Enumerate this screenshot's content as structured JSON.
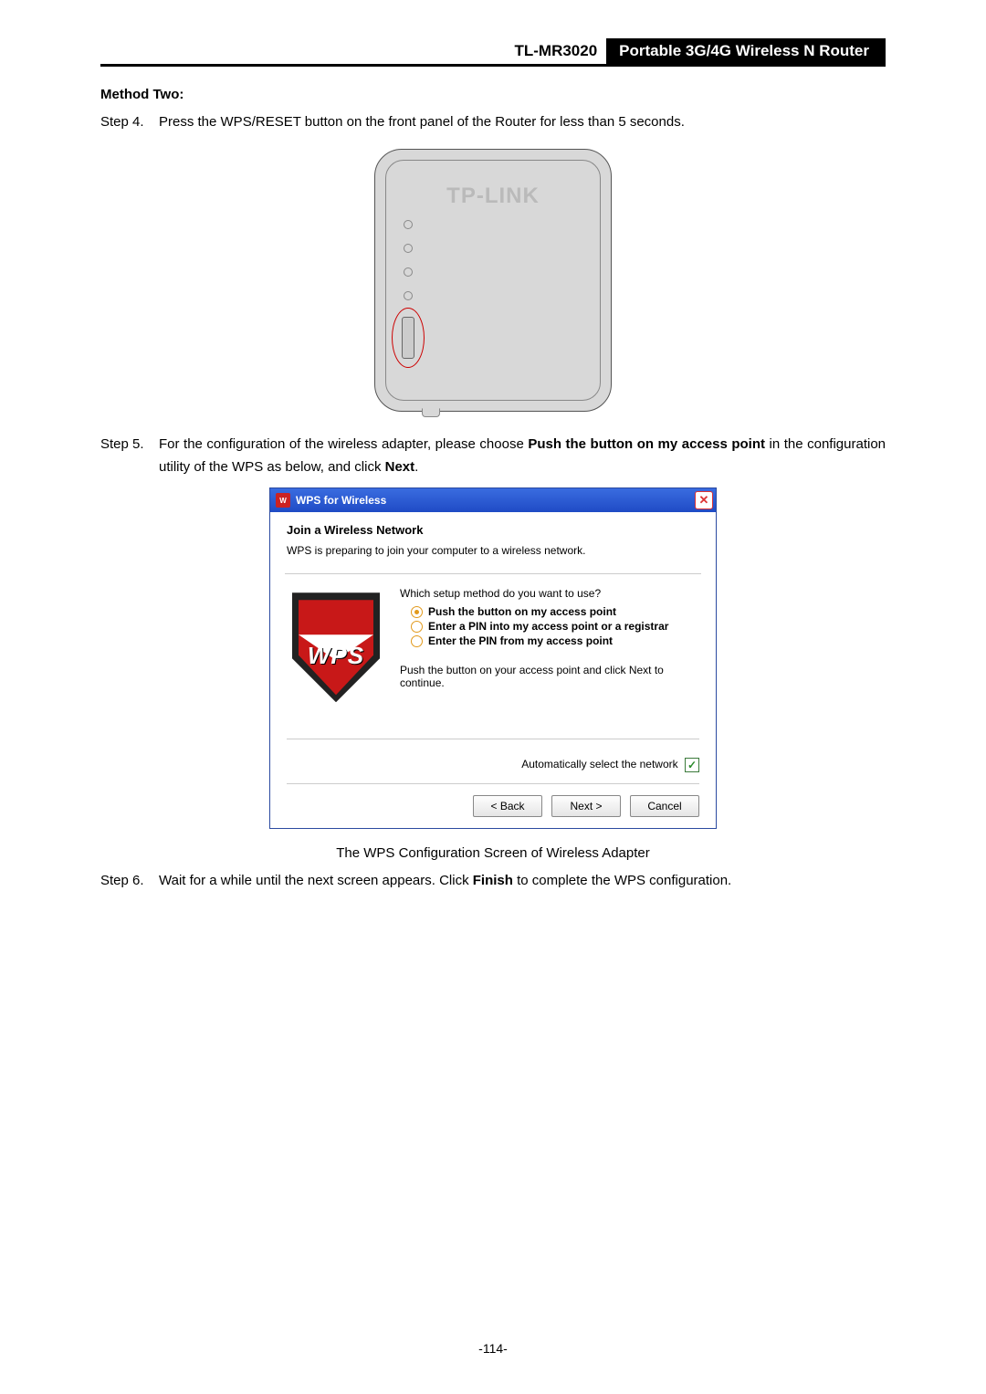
{
  "header": {
    "model": "TL-MR3020",
    "desc": "Portable 3G/4G Wireless N Router"
  },
  "section_title": "Method Two:",
  "step4": {
    "num": "Step 4.",
    "text": "Press the WPS/RESET button on the front panel of the Router for less than 5 seconds."
  },
  "router_logo": "TP-LINK",
  "step5": {
    "num": "Step 5.",
    "pre": "For the configuration of the wireless adapter, please choose ",
    "bold1": "Push the button on my access point",
    "mid": " in the configuration utility of the WPS as below, and click ",
    "bold2": "Next",
    "post": "."
  },
  "wps": {
    "title": "WPS for Wireless",
    "h1": "Join a Wireless Network",
    "sub": "WPS is preparing to join your computer to a wireless network.",
    "question": "Which setup method do you want to use?",
    "opt1": "Push the button on my access point",
    "opt2": "Enter a PIN into my access point or a registrar",
    "opt3": "Enter the PIN from my access point",
    "hint": "Push the button on your access point and click Next to continue.",
    "auto": "Automatically select the network",
    "badge": "WPS",
    "btn_back": "< Back",
    "btn_next": "Next >",
    "btn_cancel": "Cancel"
  },
  "caption": "The WPS Configuration Screen of Wireless Adapter",
  "step6": {
    "num": "Step 6.",
    "pre": "Wait for a while until the next screen appears. Click ",
    "bold": "Finish",
    "post": " to complete the WPS configuration."
  },
  "page_number": "-114-"
}
